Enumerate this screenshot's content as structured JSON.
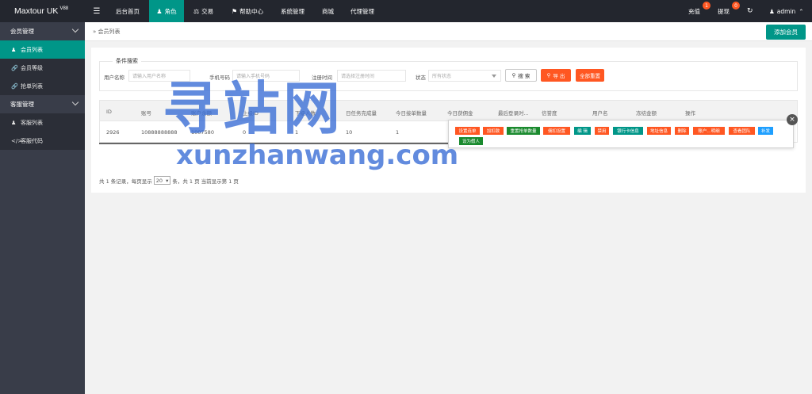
{
  "topbar": {
    "logo": "Maxtour UK",
    "logo_version": "V88",
    "nav": [
      {
        "label": "后台首页",
        "icon": ""
      },
      {
        "label": "角色",
        "icon": "user-icon"
      },
      {
        "label": "交易",
        "icon": "bank-icon"
      },
      {
        "label": "帮助中心",
        "icon": "flag-icon"
      },
      {
        "label": "系统管理",
        "icon": ""
      },
      {
        "label": "商城",
        "icon": ""
      },
      {
        "label": "代理管理",
        "icon": ""
      }
    ],
    "recharge": "充值",
    "recharge_badge": "1",
    "withdraw": "提现",
    "withdraw_badge": "0",
    "user": "admin"
  },
  "sidebar": {
    "groups": [
      {
        "label": "会员管理",
        "items": [
          {
            "label": "会员列表",
            "icon": "user-icon"
          },
          {
            "label": "会员等级",
            "icon": "link-icon"
          },
          {
            "label": "抢单列表",
            "icon": "link-icon"
          }
        ]
      },
      {
        "label": "客服管理",
        "items": [
          {
            "label": "客服列表",
            "icon": "users-icon"
          },
          {
            "label": "客服代码",
            "icon": "code-icon"
          }
        ]
      }
    ]
  },
  "breadcrumb": "会员列表",
  "add_button": "添加会员",
  "filter": {
    "legend": "条件搜索",
    "username_label": "用户名称",
    "username_placeholder": "请输入用户名称",
    "phone_label": "手机号码",
    "phone_placeholder": "请输入手机号码",
    "regtime_label": "注册时间",
    "regtime_placeholder": "请选择注册时间",
    "status_label": "状态",
    "status_value": "所有状态",
    "search_btn": "搜 索",
    "export_btn": "导 出",
    "clear_btn": "全部重置"
  },
  "table": {
    "headers": [
      "ID",
      "账号",
      "账户余额",
      "上级ID",
      "下级人数",
      "日任务完成量",
      "今日接单数量",
      "今日获佣金",
      "最后登录时...",
      "信誉度",
      "用户名",
      "冻结金额",
      "操作"
    ],
    "row": [
      "2926",
      "10888888888",
      "1007580",
      "0",
      "1",
      "10",
      "1"
    ]
  },
  "pager": {
    "text1": "共 1 条记录，每页显示",
    "page_size": "20",
    "text2": "条，共 1 页 当前显示第 1 页"
  },
  "ops": [
    {
      "label": "设置连单",
      "color": "red"
    },
    {
      "label": "加扣款",
      "color": "red"
    },
    {
      "label": "重置抢单数量",
      "color": "dgreen"
    },
    {
      "label": "佣扣设置",
      "color": "red"
    },
    {
      "label": "编 辑",
      "color": "green"
    },
    {
      "label": "禁用",
      "color": "red"
    },
    {
      "label": "银行卡信息",
      "color": "green"
    },
    {
      "label": "地址信息",
      "color": "red"
    },
    {
      "label": "删除",
      "color": "red"
    },
    {
      "label": "账户...明细",
      "color": "red"
    },
    {
      "label": "查看团队",
      "color": "red"
    },
    {
      "label": "补发",
      "color": "blue"
    },
    {
      "label": "设为假人",
      "color": "dgreen"
    }
  ],
  "watermark": {
    "cn": "寻站网",
    "en": "xunzhanwang.com"
  }
}
